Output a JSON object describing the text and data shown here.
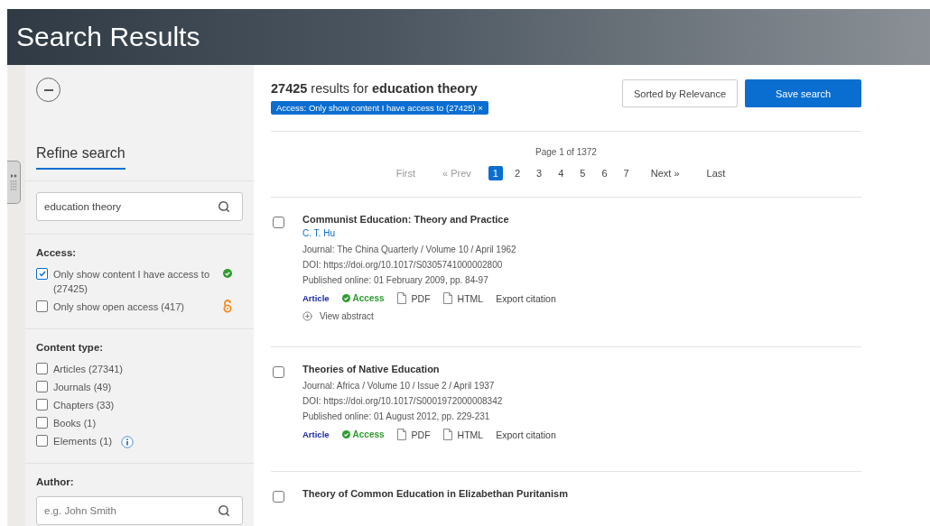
{
  "header": {
    "title": "Search Results"
  },
  "sidebar": {
    "heading": "Refine search",
    "search": {
      "value": "education theory"
    },
    "filter_groups": [
      {
        "label": "Access:",
        "options": [
          {
            "label": "Only show content I have access to (27425)",
            "checked": true,
            "kind": "check"
          },
          {
            "label": "Only show open access (417)",
            "checked": false,
            "kind": "open-access"
          }
        ]
      },
      {
        "label": "Content type:",
        "options": [
          {
            "label": "Articles (27341)",
            "checked": false
          },
          {
            "label": "Journals (49)",
            "checked": false
          },
          {
            "label": "Chapters (33)",
            "checked": false
          },
          {
            "label": "Books (1)",
            "checked": false
          },
          {
            "label": "Elements (1)",
            "checked": false,
            "kind": "info"
          }
        ]
      }
    ],
    "author": {
      "label": "Author:",
      "placeholder": "e.g. John Smith"
    }
  },
  "results_header": {
    "summary": "**27425** results for **education theory**",
    "chips": [
      "Access: Only show content I have access to (27425) ×"
    ],
    "sort": "Sorted by Relevance",
    "save": "Save search"
  },
  "pagination": {
    "summary": "Page 1 of 1372",
    "links": [
      {
        "label": "First",
        "selected": false,
        "disabled": true
      },
      {
        "label": "« Prev",
        "selected": false,
        "disabled": true
      },
      {
        "label": "1",
        "selected": true,
        "disabled": false
      },
      {
        "label": "2",
        "selected": false,
        "disabled": false
      },
      {
        "label": "3",
        "selected": false,
        "disabled": false
      },
      {
        "label": "4",
        "selected": false,
        "disabled": false
      },
      {
        "label": "5",
        "selected": false,
        "disabled": false
      },
      {
        "label": "6",
        "selected": false,
        "disabled": false
      },
      {
        "label": "7",
        "selected": false,
        "disabled": false
      },
      {
        "label": "Next »",
        "selected": false,
        "disabled": false
      },
      {
        "label": "Last",
        "selected": false,
        "disabled": false
      }
    ]
  },
  "results": [
    {
      "title": "Communist Education: Theory and Practice",
      "checked": false,
      "author": "C. T. Hu",
      "details": [
        "Journal: The China Quarterly / Volume 10 / April 1962",
        "DOI: https://doi.org/10.1017/S0305741000002800",
        "Published online: 01 February 2009, pp. 84-97"
      ],
      "type": "Article",
      "access": "Access",
      "links": [
        "PDF",
        "HTML",
        "Export citation"
      ],
      "abstract": "View abstract"
    },
    {
      "title": "Theories of Native Education",
      "checked": false,
      "details": [
        "Journal: Africa / Volume 10 / Issue 2 / April 1937",
        "DOI: https://doi.org/10.1017/S0001972000008342",
        "Published online: 01 August 2012, pp. 229-231"
      ],
      "type": "Article",
      "access": "Access",
      "links": [
        "PDF",
        "HTML",
        "Export citation"
      ]
    },
    {
      "title": "Theory of Common Education in Elizabethan Puritanism",
      "checked": false
    }
  ]
}
